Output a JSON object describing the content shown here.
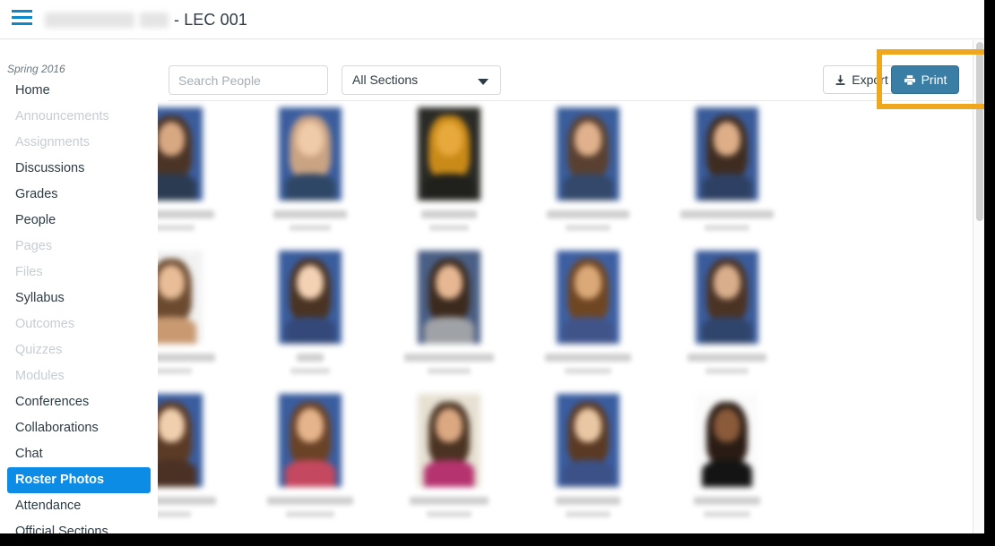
{
  "header": {
    "menu_icon": "hamburger-menu-icon",
    "course_name_redacted": true,
    "breadcrumb_suffix": "- LEC 001"
  },
  "sidebar": {
    "term": "Spring 2016",
    "items": [
      {
        "label": "Home",
        "state": "enabled"
      },
      {
        "label": "Announcements",
        "state": "disabled"
      },
      {
        "label": "Assignments",
        "state": "disabled"
      },
      {
        "label": "Discussions",
        "state": "enabled"
      },
      {
        "label": "Grades",
        "state": "enabled"
      },
      {
        "label": "People",
        "state": "enabled"
      },
      {
        "label": "Pages",
        "state": "disabled"
      },
      {
        "label": "Files",
        "state": "disabled"
      },
      {
        "label": "Syllabus",
        "state": "enabled"
      },
      {
        "label": "Outcomes",
        "state": "disabled"
      },
      {
        "label": "Quizzes",
        "state": "disabled"
      },
      {
        "label": "Modules",
        "state": "disabled"
      },
      {
        "label": "Conferences",
        "state": "enabled"
      },
      {
        "label": "Collaborations",
        "state": "enabled"
      },
      {
        "label": "Chat",
        "state": "enabled"
      },
      {
        "label": "Roster Photos",
        "state": "active"
      },
      {
        "label": "Attendance",
        "state": "enabled"
      },
      {
        "label": "Official Sections",
        "state": "enabled"
      }
    ],
    "active_item": "Roster Photos"
  },
  "toolbar": {
    "search_placeholder": "Search People",
    "search_value": "",
    "section_filter_label": "All Sections",
    "section_caret_icon": "chevron-down-icon",
    "export_label": "Export",
    "export_icon": "download-icon",
    "print_label": "Print",
    "print_icon": "printer-icon",
    "print_button_color": "#3b7ea5"
  },
  "annotation": {
    "highlight_color": "#efa81e",
    "target": "print-button"
  },
  "roster": {
    "columns": 5,
    "rows": 3,
    "names_redacted": true,
    "photos": [
      [
        {
          "bg": "#3b5d9e",
          "hair": "#4b3426",
          "skin": "#d8a882",
          "body": "#2b3b52",
          "name_w": 96,
          "id_w": 52
        },
        {
          "bg": "#3b5d9e",
          "hair": "#caa383",
          "skin": "#f0cbaa",
          "body": "#2f4766",
          "name_w": 82,
          "id_w": 46
        },
        {
          "bg": "#2a2a26",
          "hair": "#c98a18",
          "skin": "#e8a93c",
          "body": "#20201c",
          "name_w": 62,
          "id_w": 44
        },
        {
          "bg": "#3a5d9c",
          "hair": "#5a4030",
          "skin": "#e0b18c",
          "body": "#33486a",
          "name_w": 92,
          "id_w": 50
        },
        {
          "bg": "#3a5b99",
          "hair": "#3f2c20",
          "skin": "#ddae88",
          "body": "#2e4164",
          "name_w": 104,
          "id_w": 50
        }
      ],
      [
        {
          "bg": "#f2f2f2",
          "hair": "#6b4a30",
          "skin": "#e8bd97",
          "body": "#c99a72",
          "name_w": 98,
          "id_w": 46
        },
        {
          "bg": "#3a5d9e",
          "hair": "#4a3322",
          "skin": "#f3d2b4",
          "body": "#34497a",
          "name_w": 30,
          "id_w": 44
        },
        {
          "bg": "#4a5f85",
          "hair": "#3c2a1e",
          "skin": "#e6b792",
          "body": "#9fa2a6",
          "name_w": 100,
          "id_w": 48
        },
        {
          "bg": "#3d5fa2",
          "hair": "#6f4622",
          "skin": "#dba878",
          "body": "#41548a",
          "name_w": 96,
          "id_w": 52
        },
        {
          "bg": "#3a5c9c",
          "hair": "#4b3324",
          "skin": "#d9ae8c",
          "body": "#30456c",
          "name_w": 88,
          "id_w": 48
        }
      ],
      [
        {
          "bg": "#3a5d9f",
          "hair": "#5b3b26",
          "skin": "#f0cfae",
          "body": "#4b3124",
          "name_w": 100,
          "id_w": 44
        },
        {
          "bg": "#3a5d9f",
          "hair": "#6a4226",
          "skin": "#e5b48c",
          "body": "#c4485f",
          "name_w": 96,
          "id_w": 54
        },
        {
          "bg": "#e7e1d3",
          "hair": "#4a3322",
          "skin": "#dba882",
          "body": "#b5336f",
          "name_w": 88,
          "id_w": 50
        },
        {
          "bg": "#3a5da0",
          "hair": "#5a3a24",
          "skin": "#eac7a4",
          "body": "#3b5188",
          "name_w": 72,
          "id_w": 50
        },
        {
          "bg": "#fbfbfb",
          "hair": "#2a1c14",
          "skin": "#8a5a3a",
          "body": "#141414",
          "name_w": 74,
          "id_w": 52
        }
      ]
    ]
  }
}
